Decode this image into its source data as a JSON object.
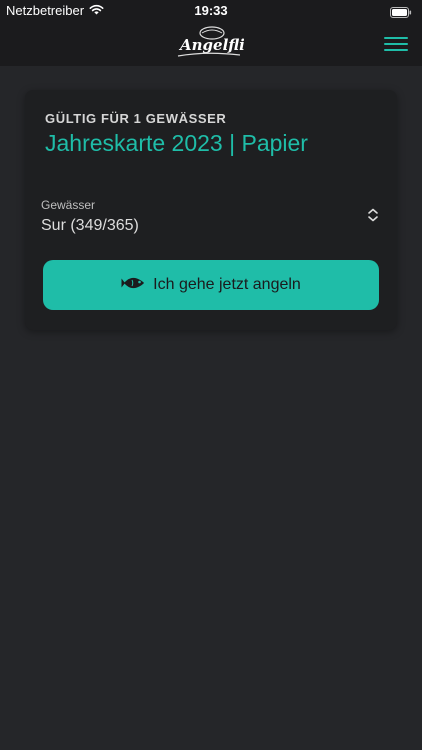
{
  "status_bar": {
    "carrier": "Netzbetreiber",
    "time": "19:33"
  },
  "header": {
    "logo_text": "Angelflix",
    "menu_icon": "hamburger-menu-icon"
  },
  "card": {
    "eyebrow": "GÜLTIG FÜR 1 GEWÄSSER",
    "title": "Jahreskarte 2023 | Papier",
    "water_field": {
      "label": "Gewässer",
      "value": "Sur (349/365)"
    },
    "action_button": {
      "label": "Ich gehe jetzt angeln",
      "icon": "fish-icon"
    }
  },
  "colors": {
    "accent": "#1fbda8",
    "background": "#252629",
    "card": "#1e1f21",
    "bar": "#1b1b1d"
  }
}
